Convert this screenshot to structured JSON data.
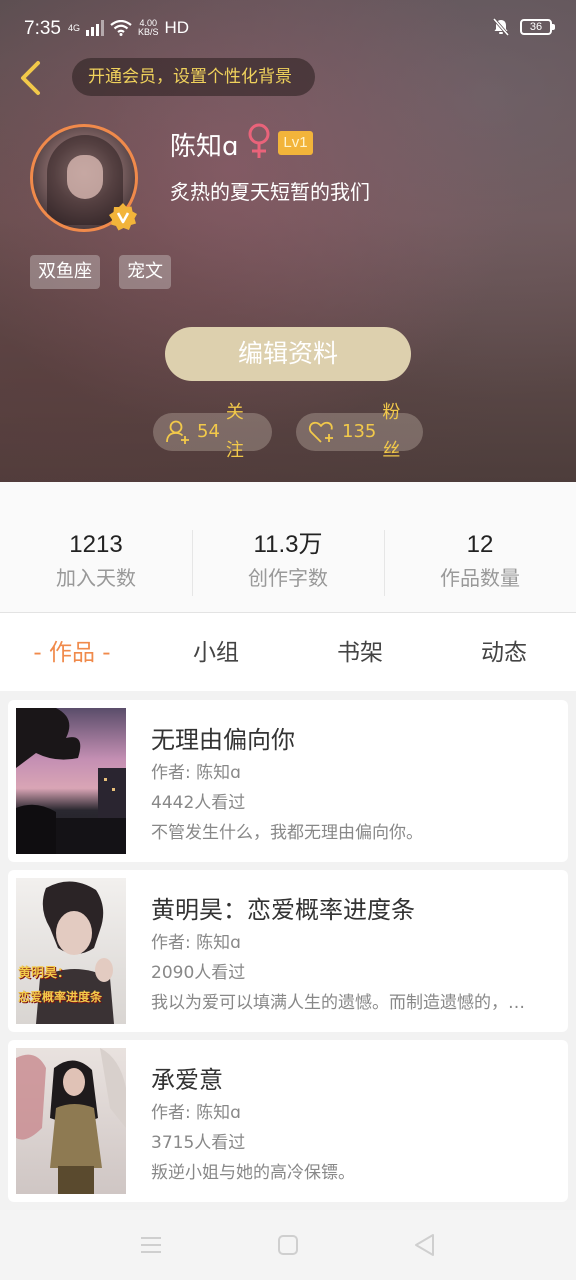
{
  "status_bar": {
    "time": "7:35",
    "network_type": "4G",
    "speed_value": "4.00",
    "speed_unit": "KB/S",
    "hd_label": "HD",
    "battery": "36",
    "icons": [
      "signal-icon",
      "wifi-icon",
      "mute-icon",
      "battery-icon"
    ]
  },
  "header": {
    "vip_banner": "开通会员，设置个性化背景",
    "username": "陈知ɑ",
    "gender_icon": "female-icon",
    "level": "Lv1",
    "bio": "炙热的夏天短暂的我们",
    "tags": [
      "双鱼座",
      "宠文"
    ],
    "edit_button": "编辑资料",
    "follow": {
      "count": "54",
      "label": "关注"
    },
    "fans": {
      "count": "135",
      "label": "粉丝"
    },
    "colors": {
      "accent_gold": "#f2c94a",
      "edit_button_bg": "#ddd0ae",
      "avatar_border": "#f08a4b",
      "level_badge": "#f2b43a"
    }
  },
  "stats": [
    {
      "value": "1213",
      "label": "加入天数"
    },
    {
      "value": "11.3万",
      "label": "创作字数"
    },
    {
      "value": "12",
      "label": "作品数量"
    }
  ],
  "tabs": [
    {
      "label": "- 作品 -",
      "active": true
    },
    {
      "label": "小组",
      "active": false
    },
    {
      "label": "书架",
      "active": false
    },
    {
      "label": "动态",
      "active": false
    }
  ],
  "tab_active_color": "#f08a4b",
  "books": [
    {
      "title": "无理由偏向你",
      "author": "作者: 陈知ɑ",
      "views": "4442人看过",
      "desc": "不管发生什么，我都无理由偏向你。",
      "cover_text": ""
    },
    {
      "title": "黄明昊：恋爱概率进度条",
      "author": "作者: 陈知ɑ",
      "views": "2090人看过",
      "desc": "我以为爱可以填满人生的遗憾。而制造遗憾的，却是爱",
      "cover_text_1": "黄明昊：",
      "cover_text_2": "恋爱概率进度条"
    },
    {
      "title": "承爱意",
      "author": "作者: 陈知ɑ",
      "views": "3715人看过",
      "desc": "叛逆小姐与她的高冷保镖。",
      "cover_text": ""
    }
  ],
  "nav_bar": {
    "icons": [
      "menu-icon",
      "home-icon",
      "back-triangle-icon"
    ]
  }
}
